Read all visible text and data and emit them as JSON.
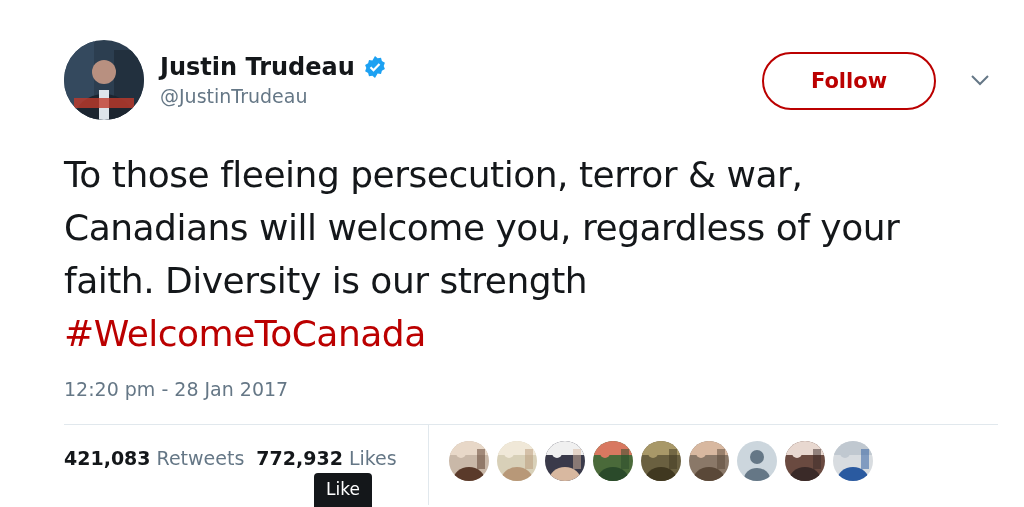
{
  "author": {
    "avatar": {
      "kind": "picture"
    },
    "name": "Justin Trudeau",
    "verified": true,
    "handle": "@JustinTrudeau"
  },
  "follow_button": {
    "label": "Follow"
  },
  "tweet": {
    "text": "To those fleeing persecution, terror & war, Canadians will welcome you, regardless of your faith. Diversity is our strength",
    "hashtag": "#WelcomeToCanada",
    "time": "12:20 pm - 28 Jan 2017"
  },
  "stats": [
    {
      "count": "421,083",
      "label": "Retweets"
    },
    {
      "count": "772,932",
      "label": "Likes"
    }
  ],
  "likers": [
    {
      "kind": "picture"
    },
    {
      "kind": "picture"
    },
    {
      "kind": "picture"
    },
    {
      "kind": "picture"
    },
    {
      "kind": "picture"
    },
    {
      "kind": "picture"
    },
    {
      "kind": "default"
    },
    {
      "kind": "picture"
    },
    {
      "kind": "picture"
    }
  ],
  "tooltip": {
    "text": "Like"
  }
}
